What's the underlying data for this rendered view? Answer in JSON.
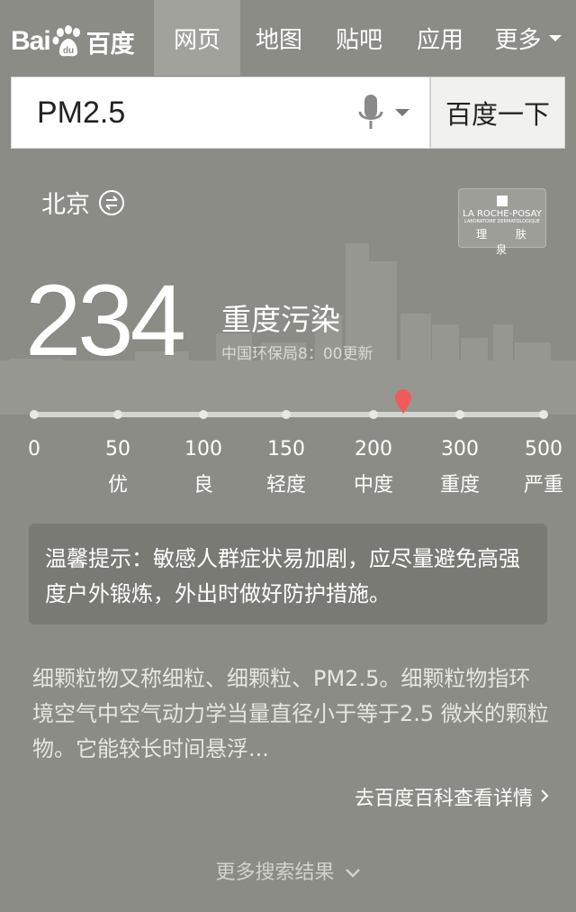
{
  "logo": {
    "latin": "Bai",
    "paw_text": "du",
    "chinese": "百度"
  },
  "nav": {
    "tabs": [
      {
        "label": "网页",
        "active": true
      },
      {
        "label": "地图"
      },
      {
        "label": "贴吧"
      },
      {
        "label": "应用"
      },
      {
        "label": "更多"
      }
    ]
  },
  "search": {
    "query": "PM2.5",
    "button_label": "百度一下"
  },
  "city": {
    "name": "北京"
  },
  "sponsor": {
    "brand": "LA ROCHE-POSAY",
    "tagline": "LABORATOIRE DERMATOLOGIQUE",
    "chinese": "理 肤 泉"
  },
  "aqi": {
    "value": "234",
    "level": "重度污染",
    "updated": "中国环保局8：00更新"
  },
  "scale": {
    "ticks": [
      {
        "value": "0",
        "grade": ""
      },
      {
        "value": "50",
        "grade": "优"
      },
      {
        "value": "100",
        "grade": "良"
      },
      {
        "value": "150",
        "grade": "轻度"
      },
      {
        "value": "200",
        "grade": "中度"
      },
      {
        "value": "300",
        "grade": "重度"
      },
      {
        "value": "500",
        "grade": "严重"
      }
    ],
    "marker_value": 234,
    "marker_color": "#f05a5a"
  },
  "tip": {
    "text": "温馨提示：敏感人群症状易加剧，应尽量避免高强度户外锻炼，外出时做好防护措施。"
  },
  "description": {
    "text": "细颗粒物又称细粒、细颗粒、PM2.5。细颗粒物指环境空气中空气动力学当量直径小于等于2.5 微米的颗粒物。它能较长时间悬浮...",
    "link": "去百度百科查看详情"
  },
  "more_results": "更多搜索结果",
  "colors": {
    "background": "#8c8c86",
    "active_tab": "#a2a29d",
    "tip_box": "#7a7a75"
  }
}
